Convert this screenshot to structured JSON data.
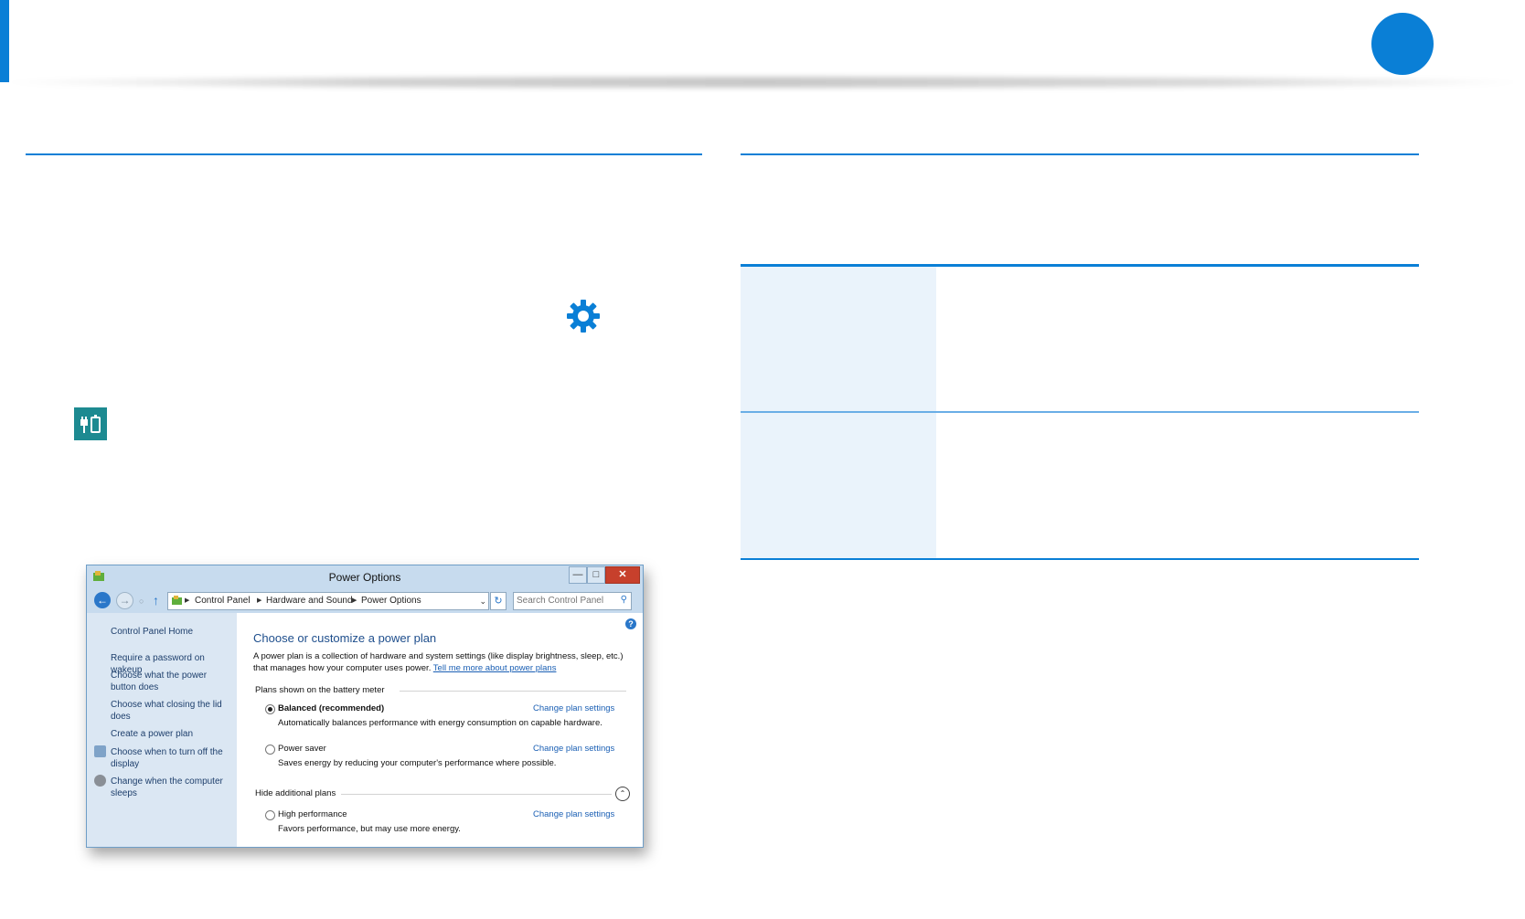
{
  "window": {
    "title": "Power Options",
    "min_glyph": "—",
    "max_glyph": "□",
    "close_glyph": "✕"
  },
  "nav": {
    "back_glyph": "←",
    "forward_glyph": "→",
    "up_glyph": "↑",
    "refresh_glyph": "↻",
    "breadcrumb": [
      "Control Panel",
      "Hardware and Sound",
      "Power Options"
    ],
    "search_placeholder": "Search Control Panel"
  },
  "sidebar": {
    "items": [
      {
        "label": "Control Panel Home"
      },
      {
        "label": "Require a password on wakeup"
      },
      {
        "label": "Choose what the power button does"
      },
      {
        "label": "Choose what closing the lid does"
      },
      {
        "label": "Create a power plan"
      },
      {
        "label": "Choose when to turn off the display",
        "icon": "display-icon"
      },
      {
        "label": "Change when the computer sleeps",
        "icon": "sleep-icon"
      }
    ]
  },
  "main": {
    "title": "Choose or customize a power plan",
    "desc": "A power plan is a collection of hardware and system settings (like display brightness, sleep, etc.) that manages how your computer uses power.",
    "desc_link": "Tell me more about power plans",
    "battery_group": "Plans shown on the battery meter",
    "hidden_group": "Hide additional plans",
    "collapse_glyph": "⌃",
    "plans": [
      {
        "name": "Balanced (recommended)",
        "desc": "Automatically balances performance with energy consumption on capable hardware.",
        "link": "Change plan settings",
        "selected": true
      },
      {
        "name": "Power saver",
        "desc": "Saves energy by reducing your computer's performance where possible.",
        "link": "Change plan settings",
        "selected": false
      },
      {
        "name": "High performance",
        "desc": "Favors performance, but may use more energy.",
        "link": "Change plan settings",
        "selected": false
      }
    ]
  },
  "colors": {
    "accent": "#0a7fd6",
    "tile": "#1d8a91",
    "table_shade": "#eaf3fb"
  }
}
